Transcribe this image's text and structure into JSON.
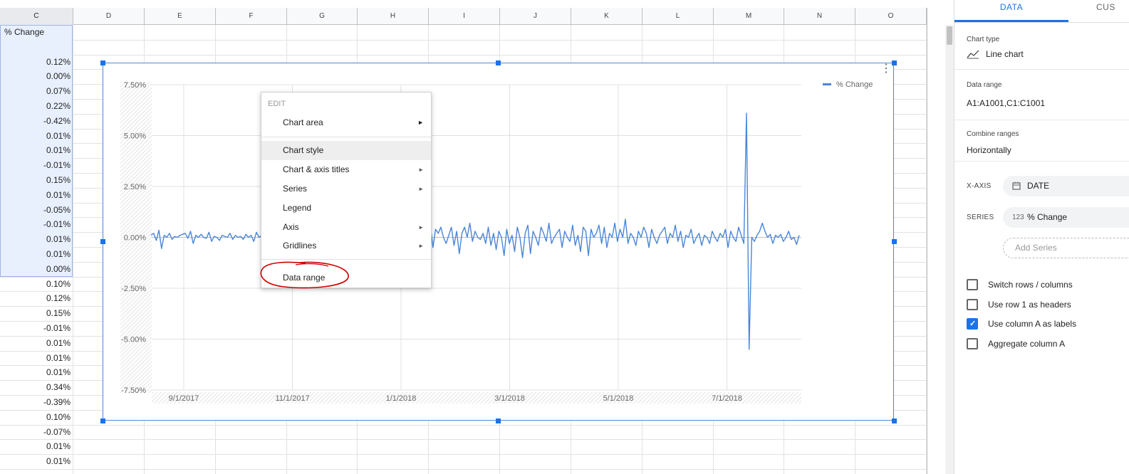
{
  "grid": {
    "columns": [
      {
        "label": "C",
        "selected": true
      },
      {
        "label": "D"
      },
      {
        "label": "E"
      },
      {
        "label": "F"
      },
      {
        "label": "G"
      },
      {
        "label": "H"
      },
      {
        "label": "I"
      },
      {
        "label": "J"
      },
      {
        "label": "K"
      },
      {
        "label": "L"
      },
      {
        "label": "M"
      },
      {
        "label": "N"
      },
      {
        "label": "O"
      }
    ],
    "c_header": "% Change",
    "c_values": [
      "",
      "0.12%",
      "0.00%",
      "0.07%",
      "0.22%",
      "-0.42%",
      "0.01%",
      "0.01%",
      "-0.01%",
      "0.15%",
      "0.01%",
      "-0.05%",
      "-0.01%",
      "0.01%",
      "0.01%",
      "0.00%",
      "0.10%",
      "0.12%",
      "0.15%",
      "-0.01%",
      "0.01%",
      "0.01%",
      "0.01%",
      "0.34%",
      "-0.39%",
      "0.10%",
      "-0.07%",
      "0.01%",
      "0.01%"
    ]
  },
  "chart_data": {
    "type": "line",
    "legend": {
      "position": "top-right",
      "entries": [
        "% Change"
      ]
    },
    "series": [
      {
        "name": "% Change",
        "color": "#4a86d8"
      }
    ],
    "x_ticks": [
      "9/1/2017",
      "11/1/2017",
      "1/1/2018",
      "3/1/2018",
      "5/1/2018",
      "7/1/2018"
    ],
    "y_ticks": [
      "7.50%",
      "5.00%",
      "2.50%",
      "0.00%",
      "-2.50%",
      "-5.00%",
      "-7.50%"
    ],
    "ylim": [
      -7.5,
      7.5
    ],
    "grid": true,
    "values": [
      0.1,
      0.2,
      -0.15,
      0.35,
      -0.55,
      0.1,
      0.0,
      0.2,
      -0.1,
      0.05,
      0.0,
      0.1,
      0.15,
      0.2,
      -0.05,
      0.3,
      -0.3,
      0.1,
      0.0,
      0.15,
      0.0,
      -0.05,
      0.25,
      -0.2,
      0.05,
      0.0,
      -0.15,
      0.1,
      0.05,
      0.0,
      0.2,
      -0.1,
      0.1,
      0.0,
      0.05,
      -0.1,
      0.15,
      0.0,
      0.1,
      -0.2,
      0.25,
      0.0,
      0.1,
      -0.05,
      0.15,
      0.0,
      0.05,
      0.2,
      -0.1,
      0.0,
      0.2,
      0.1,
      -0.15,
      0.05,
      0.0,
      0.1,
      0.0,
      -0.05,
      0.1,
      0.05,
      0.0,
      0.15,
      0.0,
      0.1,
      0.0,
      -0.1,
      0.05,
      0.0,
      0.1,
      0.0,
      0.05,
      0.0,
      -0.05,
      0.1,
      0.0,
      0.05,
      0.2,
      0.0,
      -0.1,
      0.15,
      0.0,
      0.05,
      0.0,
      0.3,
      -0.2,
      0.1,
      0.4,
      -0.3,
      0.25,
      0.0,
      0.15,
      -0.4,
      0.2,
      0.0,
      0.35,
      -0.25,
      0.1,
      -0.5,
      0.4,
      -0.9,
      0.5,
      -1.1,
      0.6,
      -1.2,
      0.5,
      0.0,
      0.6,
      -0.5,
      0.4,
      0.2,
      0.5,
      0.0,
      -0.3,
      0.1,
      0.5,
      -0.4,
      0.3,
      -0.8,
      0.2,
      0.5,
      0.0,
      0.7,
      -0.2,
      0.3,
      0.0,
      -0.1,
      0.2,
      -0.3,
      0.5,
      -0.4,
      0.2,
      -0.6,
      0.3,
      0.0,
      -0.9,
      0.4,
      -0.3,
      0.1,
      -0.7,
      0.5,
      0.0,
      -1.0,
      0.2,
      0.6,
      -0.8,
      0.3,
      0.0,
      -0.4,
      0.5,
      0.2,
      -0.2,
      0.7,
      -0.3,
      0.0,
      0.2,
      0.4,
      -0.5,
      0.3,
      0.0,
      -0.2,
      0.6,
      -0.4,
      0.1,
      -0.7,
      0.5,
      0.3,
      -0.9,
      0.4,
      0.0,
      0.2,
      0.6,
      -0.3,
      0.5,
      -0.5,
      0.2,
      0.0,
      0.7,
      -0.2,
      0.4,
      0.0,
      0.9,
      -0.3,
      0.2,
      0.0,
      -0.4,
      0.3,
      0.0,
      0.5,
      0.2,
      -0.5,
      0.4,
      0.0,
      -0.3,
      0.1,
      0.3,
      0.5,
      -0.3,
      0.2,
      0.0,
      0.6,
      -0.2,
      0.3,
      -0.5,
      0.1,
      0.0,
      0.4,
      -0.3,
      0.0,
      0.2,
      -0.4,
      0.1,
      0.0,
      -0.3,
      0.3,
      0.0,
      -0.2,
      0.2,
      0.0,
      0.4,
      -0.5,
      0.3,
      0.0,
      -0.2,
      0.5,
      0.1,
      -0.3,
      6.1,
      -5.5,
      0.0,
      -0.2,
      0.1,
      0.3,
      0.7,
      0.3,
      0.0,
      0.15,
      -0.3,
      0.1,
      0.0,
      0.15,
      -0.2,
      0.0,
      0.3,
      -0.1,
      0.0,
      -0.35,
      0.1
    ]
  },
  "context_menu": {
    "title": "EDIT",
    "items": [
      {
        "label": "Chart area",
        "submenu": true
      },
      {
        "label": "Chart style",
        "submenu": false,
        "highlighted": true
      },
      {
        "label": "Chart & axis titles",
        "submenu": true
      },
      {
        "label": "Series",
        "submenu": true
      },
      {
        "label": "Legend",
        "submenu": false
      },
      {
        "label": "Axis",
        "submenu": true
      },
      {
        "label": "Gridlines",
        "submenu": true
      },
      {
        "label": "Data range",
        "submenu": false
      }
    ],
    "annotation_color": "#cc0000"
  },
  "side_panel": {
    "tab_data": "DATA",
    "tab_customize": "CUS",
    "chart_type_label": "Chart type",
    "chart_type_value": "Line chart",
    "data_range_label": "Data range",
    "data_range_value": "A1:A1001,C1:C1001",
    "combine_label": "Combine ranges",
    "combine_value": "Horizontally",
    "x_axis_label": "X-AXIS",
    "x_axis_value": "DATE",
    "series_label": "SERIES",
    "series_value": "% Change",
    "add_series": "Add Series",
    "checkboxes": [
      {
        "label": "Switch rows / columns",
        "checked": false
      },
      {
        "label": "Use row 1 as headers",
        "checked": false
      },
      {
        "label": "Use column A as labels",
        "checked": true
      },
      {
        "label": "Aggregate column A",
        "checked": false
      }
    ]
  },
  "colors": {
    "accent": "#1a73e8",
    "line": "#4a86d8",
    "selection": "#e8f0fe"
  }
}
